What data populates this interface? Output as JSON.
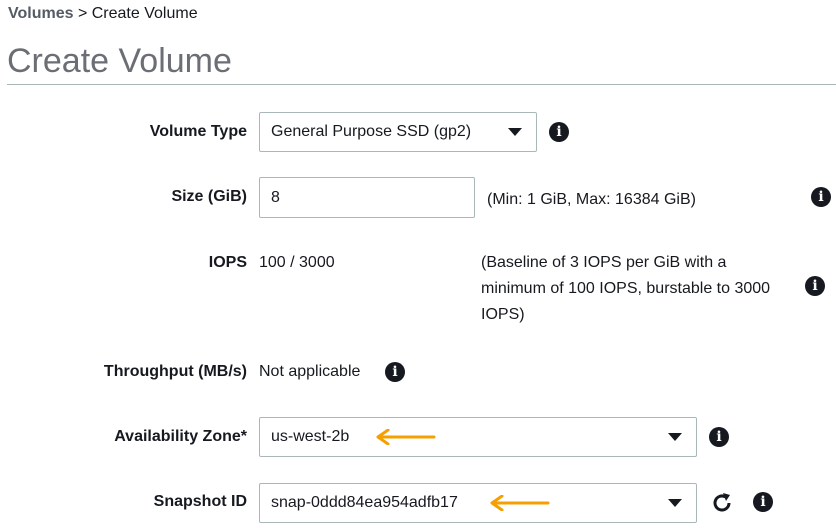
{
  "breadcrumb": {
    "parent": "Volumes",
    "separator": ">",
    "current": "Create Volume"
  },
  "page_title": "Create Volume",
  "fields": {
    "volume_type": {
      "label": "Volume Type",
      "value": "General Purpose SSD (gp2)",
      "icon": "info-icon"
    },
    "size": {
      "label": "Size (GiB)",
      "value": "8",
      "hint": "(Min: 1 GiB, Max: 16384 GiB)",
      "icon": "info-icon"
    },
    "iops": {
      "label": "IOPS",
      "value": "100 / 3000",
      "hint": "(Baseline of 3 IOPS per GiB with a minimum of 100 IOPS, burstable to 3000 IOPS)",
      "icon": "info-icon"
    },
    "throughput": {
      "label": "Throughput (MB/s)",
      "value": "Not applicable",
      "icon": "info-icon"
    },
    "availability_zone": {
      "label": "Availability Zone*",
      "value": "us-west-2b",
      "icon": "info-icon"
    },
    "snapshot_id": {
      "label": "Snapshot ID",
      "value": "snap-0ddd84ea954adfb17",
      "refresh_icon": "refresh-icon",
      "icon": "info-icon"
    }
  },
  "annotation_color": "#f5a000",
  "info_glyph": "i"
}
